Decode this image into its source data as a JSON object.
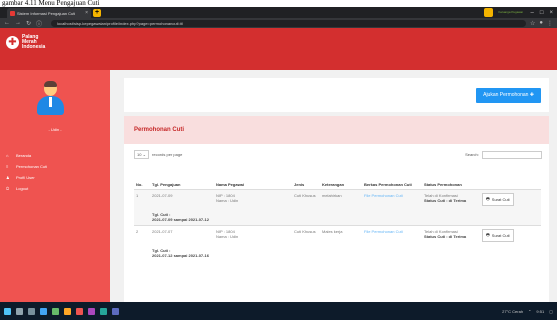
{
  "caption": "gambar 4.11 Menu Pengajuan Cuti",
  "browser": {
    "tab_title": "Sistem Informasi Pengajuan Cuti",
    "url": "localhost/sisp-kepegawaian/profile/index.php?page=permohonancuti.ttl",
    "profile_label": "Keluarga Pegawai"
  },
  "app": {
    "brand_lines": [
      "Palang",
      "Merah",
      "Indonesia"
    ]
  },
  "sidebar": {
    "username": "- Udin -",
    "items": [
      {
        "icon": "home-icon",
        "glyph": "⌂",
        "label": "Beranda"
      },
      {
        "icon": "list-icon",
        "glyph": "≡",
        "label": "Permohonan Cuti"
      },
      {
        "icon": "user-icon",
        "glyph": "♟",
        "label": "Profil User"
      },
      {
        "icon": "logout-icon",
        "glyph": "⏻",
        "label": "Logout"
      }
    ]
  },
  "main": {
    "ajukan_label": "Ajukan Permohonan ✚",
    "card_title": "Permohonan Cuti",
    "length_value": "10",
    "length_suffix": "records per page",
    "search_label": "Search:",
    "columns": [
      "No.",
      "Tgl. Pengajuan",
      "Nama Pegawai",
      "Jenis",
      "Keterangan",
      "Berkas Permohonan Cuti",
      "Status Permohonan",
      ""
    ],
    "rows": [
      {
        "no": "1",
        "tgl": "2021-07-09",
        "nip": "NIP : 1804",
        "nama": "Nama : Udin",
        "jenis": "Cuti Khusus",
        "keterangan": "melahirkan",
        "berkas": "File Permohonan Cuti",
        "status_line1": "Telah di Konfirmasi",
        "status_line2": "Status Cuti : di Terima",
        "button": "Surat Cuti",
        "detail_line1": "Tgl. Cuti :",
        "detail_line2": "2021-07-09 sampai 2021-07-12"
      },
      {
        "no": "2",
        "tgl": "2021-07-07",
        "nip": "NIP : 1804",
        "nama": "Nama : Udin",
        "jenis": "Cuti Khusus",
        "keterangan": "Males kerja",
        "berkas": "File Permohonan Cuti",
        "status_line1": "Telah di Konfirmasi",
        "status_line2": "Status Cuti : di Terima",
        "button": "Surat Cuti",
        "detail_line1": "Tgl. Cuti :",
        "detail_line2": "2021-07-12 sampai 2021-07-16"
      }
    ]
  },
  "taskbar": {
    "weather": "27°C Cerah",
    "time": "9:51"
  },
  "colors": {
    "header_red": "#d32f2f",
    "sidebar_red": "#ef5350",
    "button_blue": "#2196f3"
  }
}
